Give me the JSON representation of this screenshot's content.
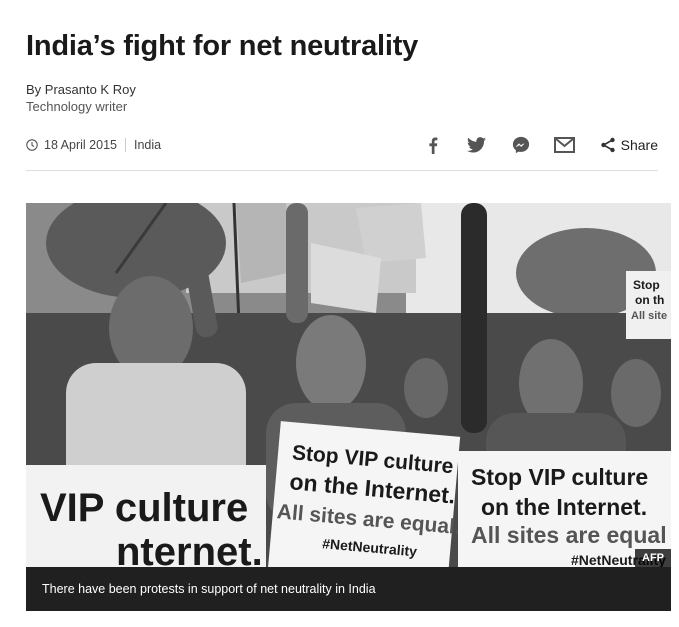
{
  "article": {
    "headline": "India’s fight for net neutrality",
    "author": "By Prasanto K Roy",
    "author_role": "Technology writer",
    "date": "18 April 2015",
    "section": "India"
  },
  "share": {
    "icons": [
      "facebook-icon",
      "twitter-icon",
      "messenger-icon",
      "email-icon"
    ],
    "label": "Share"
  },
  "image": {
    "credit": "AFP",
    "caption": "There have been protests in support of net neutrality in India",
    "placards": {
      "left_line1": "VIP culture",
      "left_line2": "nternet.",
      "center_line1": "Stop VIP culture",
      "center_line2": "on the Internet.",
      "center_line3": "All sites are equal.",
      "center_line4": "#NetNeutrality",
      "right_line1": "Stop VIP culture",
      "right_line2": "on the Internet.",
      "right_line3": "All sites are equal",
      "right_line4": "#NetNeutrality",
      "corner_line1": "Stop",
      "corner_line2": "on th",
      "corner_line3": "All site"
    }
  },
  "colors": {
    "headline": "#1a1a1a",
    "caption_bg": "#202020",
    "divider": "#dddddd"
  }
}
